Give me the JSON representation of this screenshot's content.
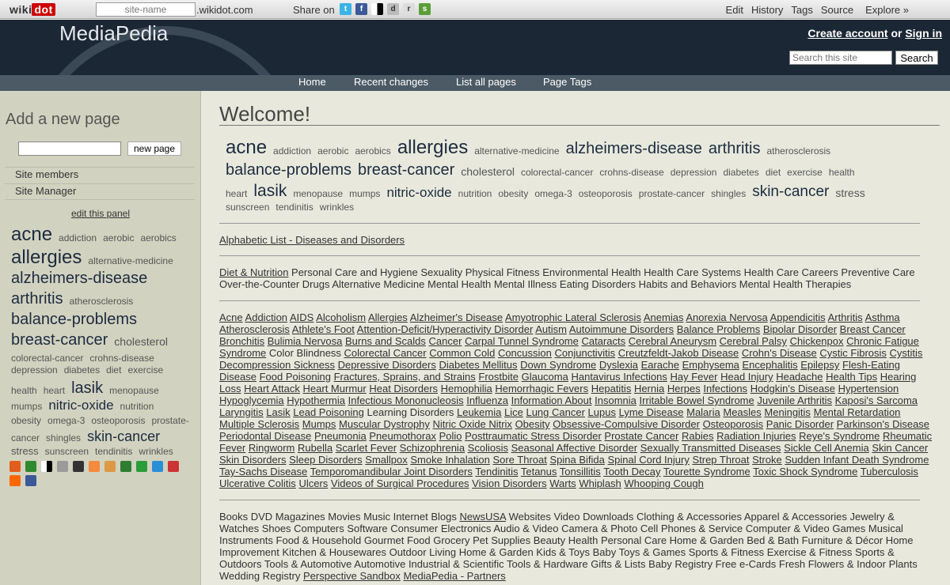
{
  "topbar": {
    "logo": "wiki",
    "logo_dot": "dot",
    "site_name_placeholder": "site-name",
    "domain": ".wikidot.com",
    "share_label": "Share on",
    "share_icons": [
      "twitter-icon",
      "facebook-icon",
      "delicious-icon",
      "digg-icon",
      "reddit-icon",
      "stumbleupon-icon"
    ],
    "nav": [
      "Edit",
      "History",
      "Tags",
      "Source",
      "Explore »"
    ]
  },
  "header": {
    "site_title": "MediaPedia",
    "create_account": "Create account",
    "or": "or",
    "sign_in": "Sign in",
    "search_placeholder": "Search this site",
    "search_button": "Search"
  },
  "navbar": [
    "Home",
    "Recent changes",
    "List all pages",
    "Page Tags"
  ],
  "sidebar": {
    "title": "Add a new page",
    "new_page_button": "new page",
    "links": [
      "Site members",
      "Site Manager"
    ],
    "edit_panel": "edit this panel",
    "cloud_lines": [
      [
        [
          "acne",
          24
        ],
        [
          "addiction",
          12
        ],
        [
          "aerobic",
          12
        ],
        [
          "aerobics",
          12
        ]
      ],
      [
        [
          "allergies",
          24
        ],
        [
          "alternative-medicine",
          12
        ]
      ],
      [
        [
          "alzheimers-disease",
          20
        ]
      ],
      [
        [
          "arthritis",
          20
        ],
        [
          "atherosclerosis",
          12
        ]
      ],
      [
        [
          "balance-problems",
          20
        ]
      ],
      [
        [
          "breast-cancer",
          20
        ],
        [
          "cholesterol",
          14
        ]
      ],
      [
        [
          "colorectal-cancer",
          12
        ],
        [
          "crohns-disease",
          12
        ]
      ],
      [
        [
          "depression",
          12
        ],
        [
          "diabetes",
          12
        ],
        [
          "diet",
          12
        ],
        [
          "exercise",
          12
        ]
      ],
      [
        [
          "health",
          12
        ],
        [
          "heart",
          12
        ],
        [
          "lasik",
          20
        ],
        [
          "menopause",
          12
        ]
      ],
      [
        [
          "mumps",
          12
        ],
        [
          "nitric-oxide",
          17
        ],
        [
          "nutrition",
          12
        ]
      ],
      [
        [
          "obesity",
          12
        ],
        [
          "omega-3",
          12
        ],
        [
          "osteoporosis",
          12
        ],
        [
          "prostate-",
          12
        ]
      ],
      [
        [
          "cancer",
          12
        ],
        [
          "shingles",
          12
        ],
        [
          "skin-cancer",
          18
        ]
      ],
      [
        [
          "stress",
          13
        ],
        [
          "sunscreen",
          12
        ],
        [
          "tendinitis",
          12
        ],
        [
          "wrinkles",
          12
        ]
      ]
    ],
    "bottom_icons": [
      "rss-icon",
      "pluck-icon",
      "delicious-icon",
      "digg-icon",
      "furl-icon",
      "orange-icon",
      "fark-icon",
      "netvibes-icon",
      "newsvine-icon",
      "n-icon",
      "reddit-icon",
      "yahoo-icon",
      "facebook-icon"
    ]
  },
  "main": {
    "title": "Welcome!",
    "cloud_lines": [
      [
        [
          "acne",
          24
        ],
        [
          "addiction",
          12
        ],
        [
          "aerobic",
          12
        ],
        [
          "aerobics",
          12
        ],
        [
          "allergies",
          24
        ],
        [
          "alternative-medicine",
          12
        ],
        [
          "alzheimers-disease",
          20
        ],
        [
          "arthritis",
          20
        ],
        [
          "atherosclerosis",
          12
        ]
      ],
      [
        [
          "balance-problems",
          20
        ],
        [
          "breast-cancer",
          20
        ],
        [
          "cholesterol",
          14
        ],
        [
          "colorectal-cancer",
          12
        ],
        [
          "crohns-disease",
          12
        ],
        [
          "depression",
          12
        ],
        [
          "diabetes",
          12
        ],
        [
          "diet",
          12
        ],
        [
          "exercise",
          12
        ],
        [
          "health",
          12
        ]
      ],
      [
        [
          "heart",
          12
        ],
        [
          "lasik",
          21
        ],
        [
          "menopause",
          12
        ],
        [
          "mumps",
          12
        ],
        [
          "nitric-oxide",
          17
        ],
        [
          "nutrition",
          12
        ],
        [
          "obesity",
          12
        ],
        [
          "omega-3",
          12
        ],
        [
          "osteoporosis",
          12
        ],
        [
          "prostate-cancer",
          12
        ],
        [
          "shingles",
          12
        ],
        [
          "skin-cancer",
          19
        ],
        [
          "stress",
          14
        ]
      ],
      [
        [
          "sunscreen",
          12
        ],
        [
          "tendinitis",
          12
        ],
        [
          "wrinkles",
          12
        ]
      ]
    ],
    "alpha_link": "Alphabetic List - Diseases and Disorders",
    "topics_first_link": "Diet & Nutrition",
    "topics_text": " Personal Care and Hygiene Sexuality Physical Fitness Environmental Health Health Care Systems Health Care Careers Preventive Care Over-the-Counter Drugs Alternative Medicine Mental Health Mental Illness Eating Disorders Habits and Behaviors Mental Health Therapies",
    "diseases": [
      "Acne",
      "Addiction",
      "AIDS",
      "Alcoholism",
      "Allergies",
      "Alzheimer's Disease",
      "Amyotrophic Lateral Sclerosis",
      "Anemias",
      "Anorexia Nervosa",
      "Appendicitis",
      "Arthritis",
      "Asthma",
      "Atherosclerosis",
      "Athlete's Foot",
      "Attention-Deficit/Hyperactivity Disorder",
      "Autism",
      "Autoimmune Disorders",
      "Balance Problems",
      "Bipolar Disorder",
      "Breast Cancer",
      "Bronchitis",
      "Bulimia Nervosa",
      "Burns and Scalds",
      "Cancer",
      "Carpal Tunnel Syndrome",
      "Cataracts",
      "Cerebral Aneurysm",
      "Cerebral Palsy",
      "Chickenpox",
      "Chronic Fatigue Syndrome",
      "Color Blindness",
      "Colorectal Cancer",
      "Common Cold",
      "Concussion",
      "Conjunctivitis",
      "Creutzfeldt-Jakob Disease",
      "Crohn's Disease",
      "Cystic Fibrosis",
      "Cystitis",
      "Decompression Sickness",
      "Depressive Disorders",
      "Diabetes Mellitus",
      "Down Syndrome",
      "Dyslexia",
      "Earache",
      "Emphysema",
      "Encephalitis",
      "Epilepsy",
      "Flesh-Eating Disease",
      "Food Poisoning",
      "Fractures, Sprains, and Strains",
      "Frostbite",
      "Glaucoma",
      "Hantavirus Infections",
      "Hay Fever",
      "Head Injury",
      "Headache",
      "Health Tips",
      "Hearing Loss",
      "Heart Attack",
      "Heart Murmur",
      "Heat Disorders",
      "Hemophilia",
      "Hemorrhagic Fevers",
      "Hepatitis",
      "Hernia",
      "Herpes",
      "Infections",
      "Hodgkin's Disease",
      "Hypertension",
      "Hypoglycemia",
      "Hypothermia",
      "Infectious Mononucleosis",
      "Influenza",
      "Information About",
      "Insomnia",
      "Irritable Bowel Syndrome",
      "Juvenile Arthritis",
      "Kaposi's Sarcoma",
      "Laryngitis",
      "Lasik",
      "Lead Poisoning",
      "Learning Disorders",
      "Leukemia",
      "Lice",
      "Lung Cancer",
      "Lupus",
      "Lyme Disease",
      "Malaria",
      "Measles",
      "Meningitis",
      "Mental Retardation",
      "Multiple Sclerosis",
      "Mumps",
      "Muscular Dystrophy",
      "Nitric Oxide Nitrix",
      "Obesity",
      "Obsessive-Compulsive Disorder",
      "Osteoporosis",
      "Panic Disorder",
      "Parkinson's Disease",
      "Periodontal Disease",
      "Pneumonia",
      "Pneumothorax",
      "Polio",
      "Posttraumatic Stress Disorder",
      "Prostate Cancer",
      "Rabies",
      "Radiation Injuries",
      "Reye's Syndrome",
      "Rheumatic Fever",
      "Ringworm",
      "Rubella",
      "Scarlet Fever",
      "Schizophrenia",
      "Scoliosis",
      "Seasonal Affective Disorder",
      "Sexually Transmitted Diseases",
      "Sickle Cell Anemia",
      "Skin Cancer",
      "Skin Disorders",
      "Sleep Disorders",
      "Smallpox",
      "Smoke Inhalation",
      "Sore Throat",
      "Spina Bifida",
      "Spinal Cord Injury",
      "Strep Throat",
      "Stroke",
      "Sudden Infant Death Syndrome",
      "Tay-Sachs Disease",
      "Temporomandibular Joint Disorders",
      "Tendinitis",
      "Tetanus",
      "Tonsillitis",
      "Tooth Decay",
      "Tourette Syndrome",
      "Toxic Shock Syndrome",
      "Tuberculosis",
      "Ulcerative Colitis",
      "Ulcers",
      "Videos of Surgical Procedures",
      "Vision Disorders",
      "Warts",
      "Whiplash",
      "Whooping Cough"
    ],
    "unlinked_diseases": [
      "Color Blindness",
      "Learning Disorders"
    ],
    "shop_text_1": "Books DVD Magazines Movies Music Internet Blogs ",
    "shop_link_1": "NewsUSA",
    "shop_text_2": " Websites Video Downloads Clothing & Accessories Apparel & Accessories Jewelry & Watches Shoes Computers Software Consumer Electronics Audio & Video Camera & Photo Cell Phones & Service Computer & Video Games Musical Instruments Food & Household Gourmet Food Grocery Pet Supplies Beauty Health Personal Care Home & Garden Bed & Bath Furniture & Décor Home Improvement Kitchen & Housewares Outdoor Living Home & Garden Kids & Toys Baby Toys & Games Sports & Fitness Exercise & Fitness Sports & Outdoors Tools & Automotive Automotive Industrial & Scientific Tools & Hardware Gifts & Lists Baby Registry Free e-Cards Fresh Flowers & Indoor Plants Wedding Registry ",
    "shop_link_2": "Perspective Sandbox",
    "shop_link_3": "MediaPedia - Partners"
  }
}
